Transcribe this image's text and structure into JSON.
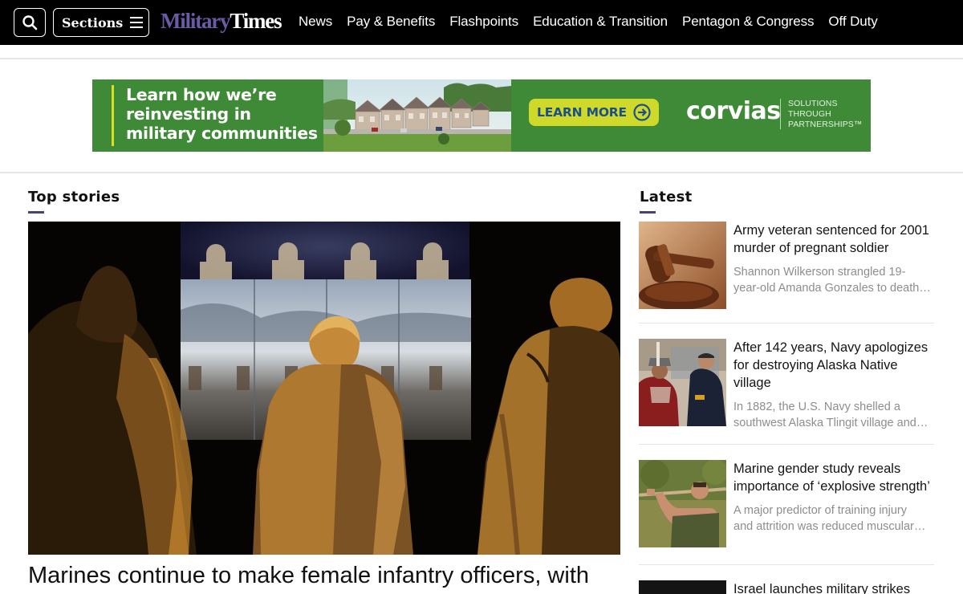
{
  "nav": {
    "sections_label": "Sections",
    "logo_part1": "Military",
    "logo_part2": "Times",
    "links": [
      "News",
      "Pay & Benefits",
      "Flashpoints",
      "Education & Transition",
      "Pentagon & Congress",
      "Off Duty"
    ]
  },
  "ad": {
    "headline_lines": [
      "Learn how we’re",
      "reinvesting in",
      "military communities"
    ],
    "button_label": "LEARN MORE",
    "brand": "corvias",
    "tagline_lines": [
      "SOLUTIONS",
      "THROUGH",
      "PARTNERSHIPS™"
    ],
    "colors": {
      "background": "#3e8a36",
      "button": "#cfd92a",
      "accent": "#d9e021"
    }
  },
  "top_stories": {
    "title": "Top stories",
    "lead_headline": "Marines continue to make female infantry officers, with"
  },
  "latest": {
    "title": "Latest",
    "items": [
      {
        "headline": "Army veteran sentenced for 2001 murder of pregnant soldier",
        "summary_lines": [
          "Shannon Wilkerson strangled 19-",
          "year-old Amanda Gonzales to death…"
        ],
        "thumb_icon": "gavel-photo"
      },
      {
        "headline": "After 142 years, Navy apologizes for destroying Alaska Native village",
        "summary_lines": [
          "In 1882, the U.S. Navy shelled a",
          "southwest Alaska Tlingit village and…"
        ],
        "thumb_icon": "ceremony-photo"
      },
      {
        "headline": "Marine gender study reveals importance of ‘explosive strength’",
        "summary_lines": [
          "A major predictor of training injury",
          "and attrition was reduced muscular…"
        ],
        "thumb_icon": "pullup-photo"
      },
      {
        "headline": "Israel launches military strikes",
        "summary_lines": [],
        "thumb_icon": "dark-photo"
      }
    ]
  },
  "colors": {
    "accent": "#4c3f7e",
    "logo_purple": "#6b5ba6"
  }
}
